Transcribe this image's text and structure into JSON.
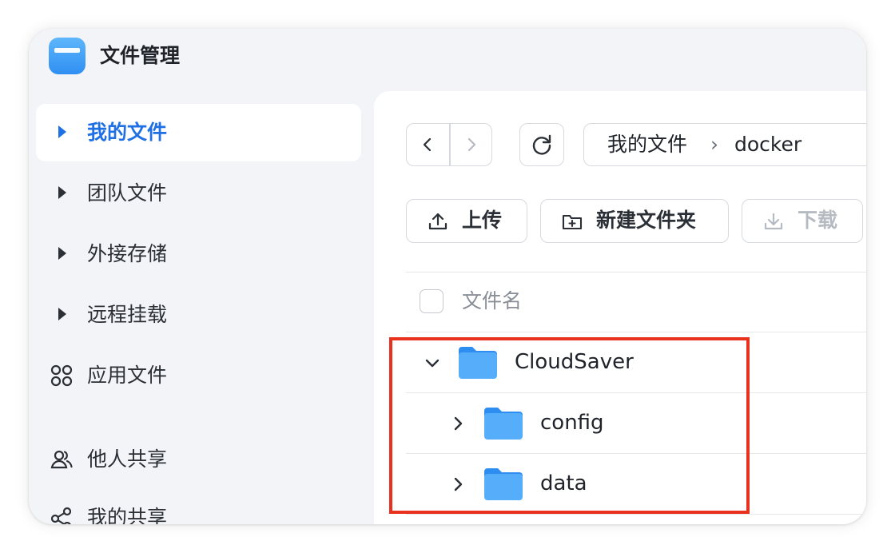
{
  "app": {
    "title": "文件管理",
    "icon": "folder-app-icon",
    "accent": "#1f6fe5"
  },
  "sidebar": {
    "items": [
      {
        "label": "我的文件",
        "icon": "caret-right-icon",
        "active": true
      },
      {
        "label": "团队文件",
        "icon": "caret-right-icon"
      },
      {
        "label": "外接存储",
        "icon": "caret-right-icon"
      },
      {
        "label": "远程挂载",
        "icon": "caret-right-icon"
      },
      {
        "label": "应用文件",
        "icon": "apps-grid-icon"
      },
      {
        "label": "他人共享",
        "icon": "users-icon"
      },
      {
        "label": "我的共享",
        "icon": "share-icon"
      }
    ]
  },
  "navigation": {
    "back_icon": "chevron-left-icon",
    "forward_icon": "chevron-right-icon",
    "refresh_icon": "refresh-icon",
    "breadcrumb": [
      "我的文件",
      "docker"
    ],
    "separator": "›"
  },
  "toolbar": {
    "upload": "上传",
    "new_folder": "新建文件夹",
    "download": "下载"
  },
  "table": {
    "columns": [
      "文件名"
    ],
    "rows": [
      {
        "name": "CloudSaver",
        "expanded": true,
        "level": 0,
        "icon": "folder-icon"
      },
      {
        "name": "config",
        "expanded": false,
        "level": 1,
        "icon": "folder-icon"
      },
      {
        "name": "data",
        "expanded": false,
        "level": 1,
        "icon": "folder-icon"
      }
    ]
  },
  "highlight_color": "#e8321e"
}
